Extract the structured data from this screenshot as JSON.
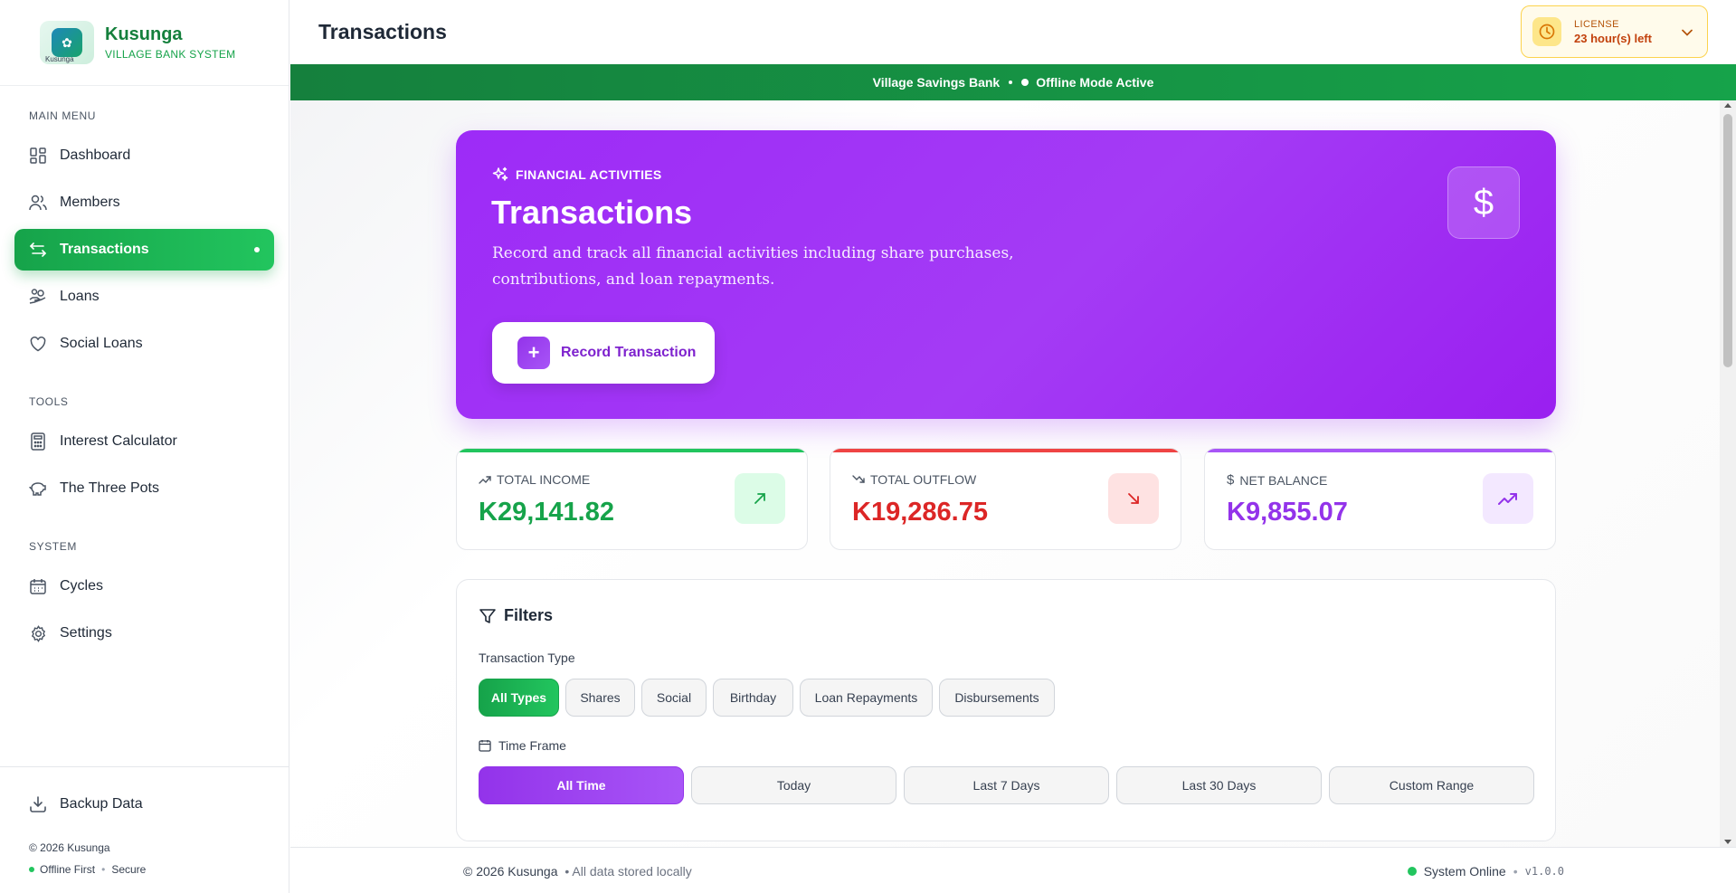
{
  "brand": {
    "name": "Kusunga",
    "subtitle": "VILLAGE BANK SYSTEM",
    "logo_caption": "Kusunga"
  },
  "sidebar": {
    "main_menu_label": "MAIN MENU",
    "main_items": [
      {
        "label": "Dashboard",
        "icon": "dashboard-icon"
      },
      {
        "label": "Members",
        "icon": "users-icon"
      },
      {
        "label": "Transactions",
        "icon": "transfer-arrows-icon",
        "active": true
      },
      {
        "label": "Loans",
        "icon": "hand-coins-icon"
      },
      {
        "label": "Social Loans",
        "icon": "heart-icon"
      }
    ],
    "tools_label": "TOOLS",
    "tools_items": [
      {
        "label": "Interest Calculator",
        "icon": "calculator-icon"
      },
      {
        "label": "The Three Pots",
        "icon": "piggy-bank-icon"
      }
    ],
    "system_label": "SYSTEM",
    "system_items": [
      {
        "label": "Cycles",
        "icon": "calendar-icon"
      },
      {
        "label": "Settings",
        "icon": "gear-icon"
      }
    ],
    "backup_label": "Backup Data",
    "copyright": "© 2026 Kusunga",
    "status_offline": "Offline First",
    "status_secure": "Secure"
  },
  "header": {
    "title": "Transactions",
    "license_label": "LICENSE",
    "license_value": "23 hour(s) left"
  },
  "banner": {
    "bank_name": "Village Savings Bank",
    "mode": "Offline Mode Active"
  },
  "hero": {
    "kicker": "FINANCIAL ACTIVITIES",
    "title": "Transactions",
    "description": "Record and track all financial activities including share purchases, contributions, and loan repayments.",
    "button_label": "Record Transaction",
    "dollar_symbol": "$"
  },
  "stats": [
    {
      "label": "TOTAL INCOME",
      "value": "K29,141.82",
      "color": "#16a34a",
      "accent": "#22c55e",
      "icon": "arrow-up-right-icon"
    },
    {
      "label": "TOTAL OUTFLOW",
      "value": "K19,286.75",
      "color": "#dc2626",
      "accent": "#ef4444",
      "icon": "arrow-down-right-icon"
    },
    {
      "label": "NET BALANCE",
      "value": "K9,855.07",
      "color": "#9333ea",
      "accent": "#a855f7",
      "icon": "trending-up-icon"
    }
  ],
  "filters": {
    "title": "Filters",
    "type_label": "Transaction Type",
    "types": [
      "All Types",
      "Shares",
      "Social",
      "Birthday",
      "Loan Repayments",
      "Disbursements"
    ],
    "active_type": "All Types",
    "timeframe_label": "Time Frame",
    "timeframes": [
      "All Time",
      "Today",
      "Last 7 Days",
      "Last 30 Days",
      "Custom Range"
    ],
    "active_timeframe": "All Time"
  },
  "footer": {
    "copyright": "© 2026 Kusunga",
    "storage": "• All data stored locally",
    "system_status": "System Online",
    "version": "v1.0.0"
  },
  "colors": {
    "brand_green": "#16a34a",
    "purple": "#9d2bf7",
    "license_bg": "#fffbeb"
  }
}
